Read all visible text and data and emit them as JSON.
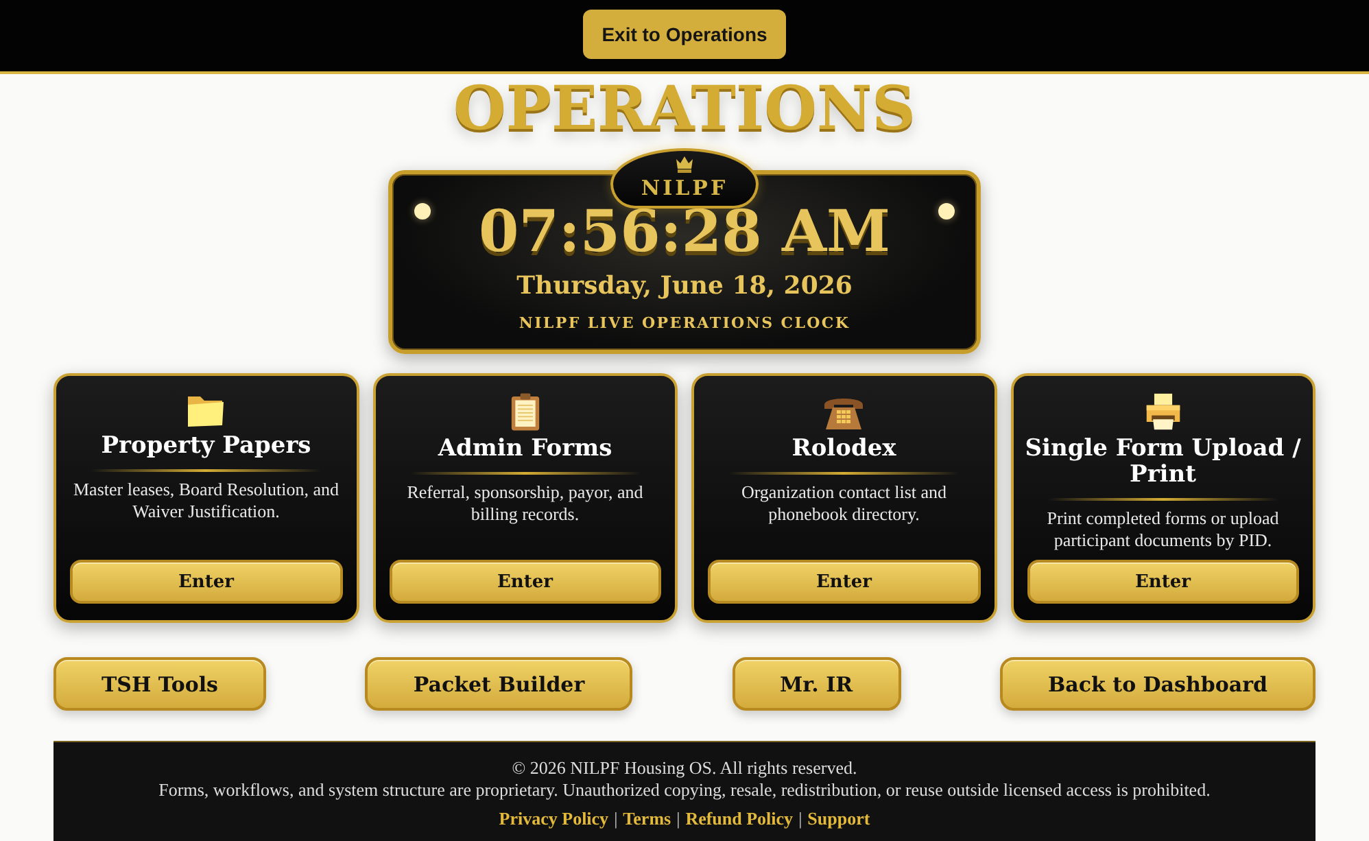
{
  "top_bar": {
    "exit_button": "Exit to Operations"
  },
  "page_title": "OPERATIONS",
  "clock": {
    "badge": "NILPF",
    "time": "07:56:28 AM",
    "date": "Thursday, June 18, 2026",
    "caption": "NILPF LIVE OPERATIONS CLOCK"
  },
  "cards": [
    {
      "kind": "folder",
      "title": "Property Papers",
      "description": "Master leases, Board Resolution, and Waiver Justification.",
      "button": "Enter"
    },
    {
      "kind": "clipboard",
      "title": "Admin Forms",
      "description": "Referral, sponsorship, payor, and billing records.",
      "button": "Enter"
    },
    {
      "kind": "telephone",
      "title": "Rolodex",
      "description": "Organization contact list and phonebook directory.",
      "button": "Enter"
    },
    {
      "kind": "printer",
      "title": "Single Form Upload / Print",
      "description": "Print completed forms or upload participant documents by PID.",
      "button": "Enter"
    }
  ],
  "nav_buttons": [
    "TSH Tools",
    "Packet Builder",
    "Mr. IR",
    "Back to Dashboard"
  ],
  "footer": {
    "copyright": "© 2026 NILPF Housing OS. All rights reserved.",
    "notice": "Forms, workflows, and system structure are proprietary. Unauthorized copying, resale, redistribution, or reuse outside licensed access is prohibited.",
    "link_line": [
      {
        "kind": "link",
        "text": "Privacy Policy"
      },
      {
        "kind": "separator",
        "text": "|"
      },
      {
        "kind": "link",
        "text": "Terms"
      },
      {
        "kind": "separator",
        "text": "|"
      },
      {
        "kind": "link",
        "text": "Refund Policy"
      },
      {
        "kind": "separator",
        "text": "|"
      },
      {
        "kind": "link",
        "text": "Support"
      }
    ]
  }
}
